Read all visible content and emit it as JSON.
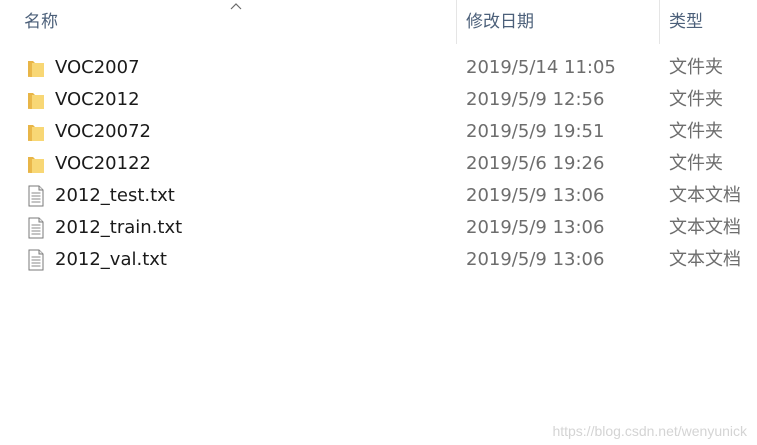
{
  "columns": {
    "name": "名称",
    "date": "修改日期",
    "type": "类型"
  },
  "sort": {
    "column": "name",
    "direction": "ascending",
    "indicator_icon": "chevron-up-icon"
  },
  "files": [
    {
      "name": "VOC2007",
      "date": "2019/5/14 11:05",
      "type": "文件夹",
      "icon": "folder-icon"
    },
    {
      "name": "VOC2012",
      "date": "2019/5/9 12:56",
      "type": "文件夹",
      "icon": "folder-icon"
    },
    {
      "name": "VOC20072",
      "date": "2019/5/9 19:51",
      "type": "文件夹",
      "icon": "folder-icon"
    },
    {
      "name": "VOC20122",
      "date": "2019/5/6 19:26",
      "type": "文件夹",
      "icon": "folder-icon"
    },
    {
      "name": "2012_test.txt",
      "date": "2019/5/9 13:06",
      "type": "文本文档",
      "icon": "text-file-icon"
    },
    {
      "name": "2012_train.txt",
      "date": "2019/5/9 13:06",
      "type": "文本文档",
      "icon": "text-file-icon"
    },
    {
      "name": "2012_val.txt",
      "date": "2019/5/9 13:06",
      "type": "文本文档",
      "icon": "text-file-icon"
    }
  ],
  "colors": {
    "header_text": "#4c607a",
    "date_text": "#6d6d6d",
    "folder_yellow": "#f8d775",
    "folder_dark": "#e8b547"
  },
  "watermark": "https://blog.csdn.net/wenyunick"
}
